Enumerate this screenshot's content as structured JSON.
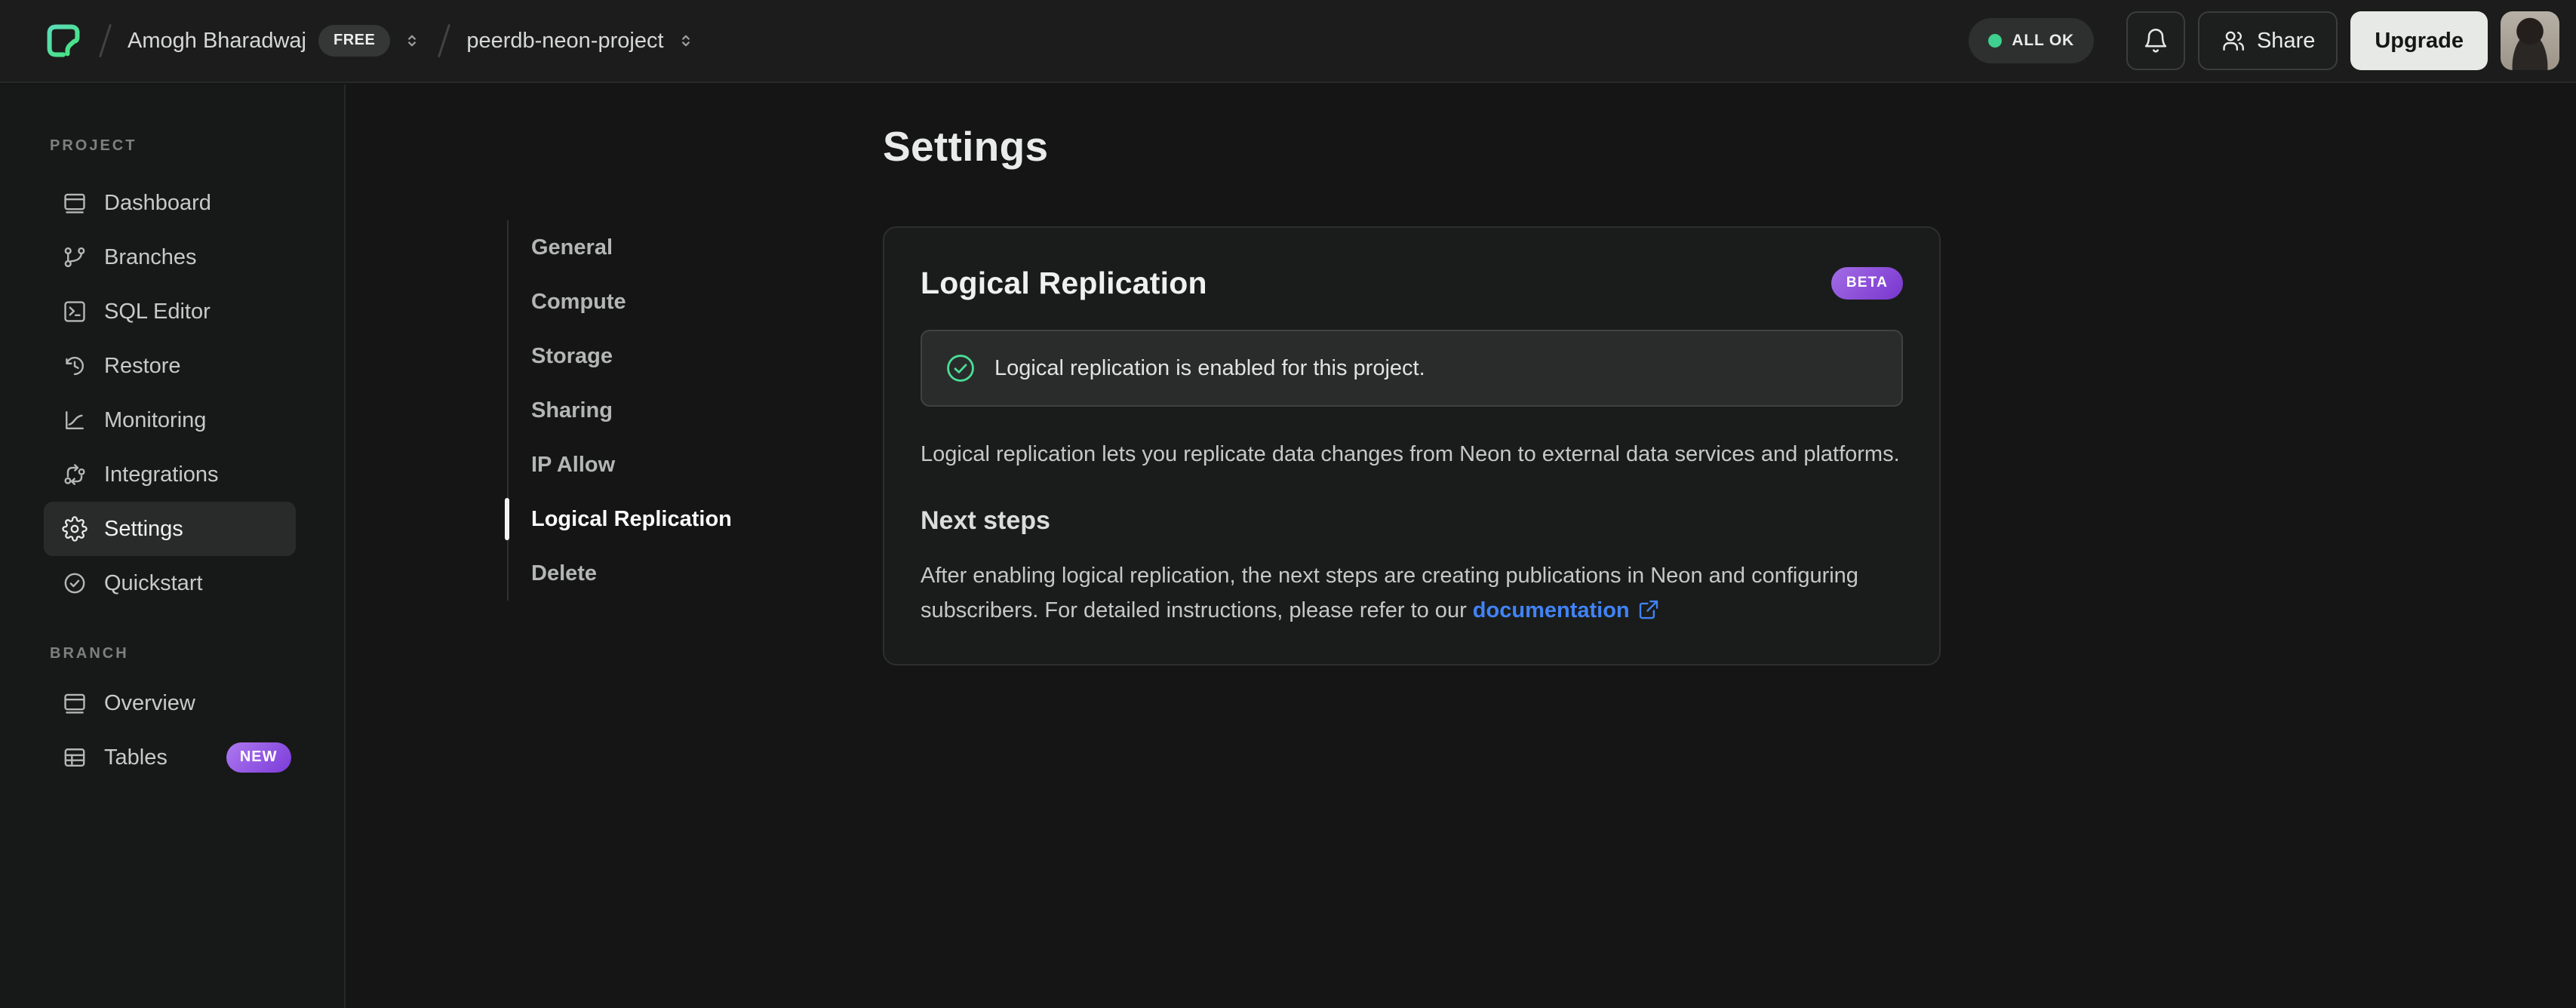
{
  "topbar": {
    "org_name": "Amogh Bharadwaj",
    "plan_badge": "FREE",
    "project_name": "peerdb-neon-project",
    "status_badge": "ALL OK",
    "share_label": "Share",
    "upgrade_label": "Upgrade"
  },
  "sidebar": {
    "project_section_label": "PROJECT",
    "project_items": [
      {
        "label": "Dashboard",
        "icon": "dashboard-icon"
      },
      {
        "label": "Branches",
        "icon": "branches-icon"
      },
      {
        "label": "SQL Editor",
        "icon": "sql-editor-icon"
      },
      {
        "label": "Restore",
        "icon": "restore-icon"
      },
      {
        "label": "Monitoring",
        "icon": "monitoring-icon"
      },
      {
        "label": "Integrations",
        "icon": "integrations-icon"
      },
      {
        "label": "Settings",
        "icon": "settings-icon",
        "active": true
      },
      {
        "label": "Quickstart",
        "icon": "quickstart-icon"
      }
    ],
    "branch_section_label": "BRANCH",
    "branch_items": [
      {
        "label": "Overview",
        "icon": "overview-icon"
      },
      {
        "label": "Tables",
        "icon": "tables-icon",
        "badge": "NEW"
      }
    ]
  },
  "main": {
    "page_title": "Settings",
    "settings_nav": [
      "General",
      "Compute",
      "Storage",
      "Sharing",
      "IP Allow",
      "Logical Replication",
      "Delete"
    ],
    "settings_nav_active": "Logical Replication",
    "card": {
      "title": "Logical Replication",
      "beta_badge": "BETA",
      "alert_text": "Logical replication is enabled for this project.",
      "description": "Logical replication lets you replicate data changes from Neon to external data services and platforms.",
      "next_steps_title": "Next steps",
      "next_steps_text": "After enabling logical replication, the next steps are creating publications in Neon and configuring subscribers. For detailed instructions, please refer to our ",
      "link_text": "documentation"
    }
  },
  "colors": {
    "brand_green": "#3ee56e",
    "brand_teal": "#62d9c8",
    "status_green": "#3fcf8e",
    "success_check_green": "#4ade97",
    "badge_purple_start": "#ae79ef",
    "badge_purple_end": "#7b3bd9",
    "link_blue": "#4183f6",
    "topbar_bg": "#1b1c1b",
    "sidebar_bg": "#171918",
    "main_bg": "#141514",
    "card_bg": "#1a1c1b",
    "alert_bg": "#2a2c2b"
  }
}
